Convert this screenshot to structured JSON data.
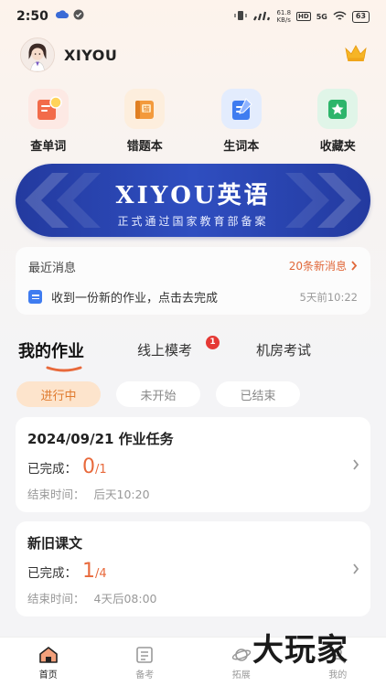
{
  "status_bar": {
    "time": "2:50",
    "network_speed_top": "61.8",
    "network_speed_bottom": "KB/s",
    "hd": "HD",
    "signal": "5G",
    "battery": "63"
  },
  "header": {
    "username": "XIYOU"
  },
  "quick_actions": [
    {
      "label": "查单词",
      "icon": "search-word-icon",
      "color": "#f26b4a"
    },
    {
      "label": "错题本",
      "icon": "mistake-book-icon",
      "color": "#f39a3c"
    },
    {
      "label": "生词本",
      "icon": "vocabulary-book-icon",
      "color": "#3f7cf0"
    },
    {
      "label": "收藏夹",
      "icon": "favorites-icon",
      "color": "#2db56b"
    }
  ],
  "banner": {
    "title": "XIYOU英语",
    "subtitle": "正式通过国家教育部备案"
  },
  "news": {
    "heading": "最近消息",
    "count_label": "20条新消息",
    "message": "收到一份新的作业，点击去完成",
    "time": "5天前10:22"
  },
  "tabs": [
    {
      "label": "我的作业",
      "active": true
    },
    {
      "label": "线上模考",
      "badge": "1"
    },
    {
      "label": "机房考试"
    }
  ],
  "filters": [
    {
      "label": "进行中",
      "active": true
    },
    {
      "label": "未开始"
    },
    {
      "label": "已结束"
    }
  ],
  "tasks": [
    {
      "title": "2024/09/21 作业任务",
      "progress_label": "已完成：",
      "done": "0",
      "total": "/1",
      "end_label": "结束时间：",
      "end_time": "后天10:20"
    },
    {
      "title": "新旧课文",
      "progress_label": "已完成：",
      "done": "1",
      "total": "/4",
      "end_label": "结束时间：",
      "end_time": "4天后08:00"
    }
  ],
  "bottom_nav": [
    {
      "label": "首页",
      "active": true
    },
    {
      "label": "备考"
    },
    {
      "label": "拓展"
    },
    {
      "label": "我的"
    }
  ],
  "watermark": "大玩家",
  "colors": {
    "accent_orange": "#e8693b",
    "banner_blue": "#2f4ec0",
    "chip_active_bg": "#fde4cc"
  }
}
